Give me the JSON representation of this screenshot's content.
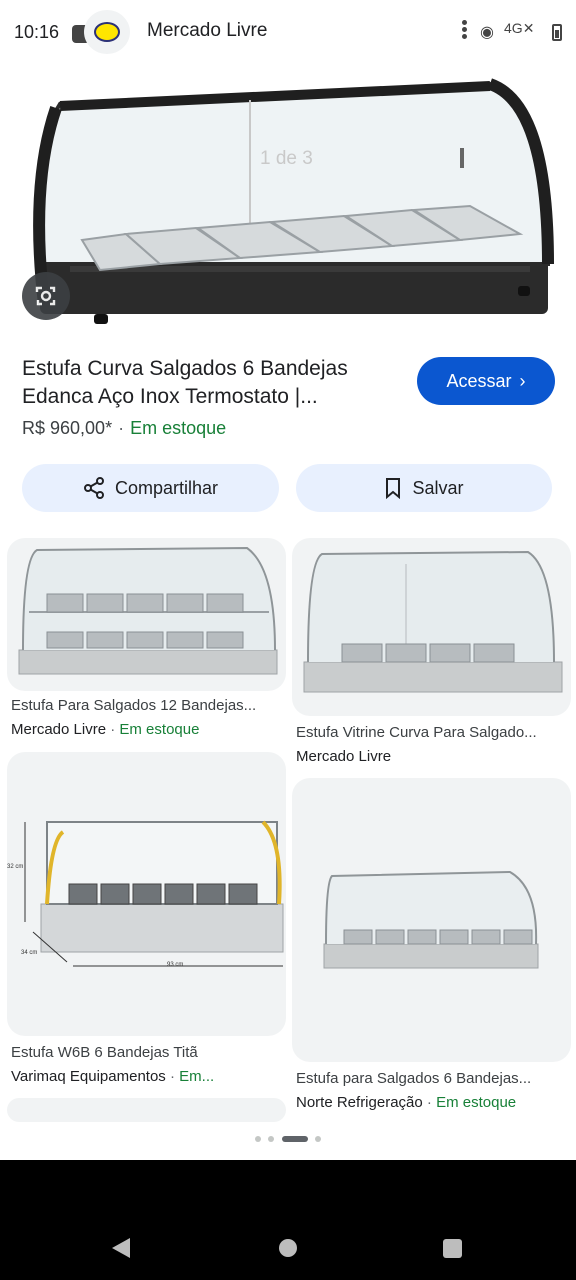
{
  "status_bar": {
    "time": "10:16",
    "network": "4G",
    "site_title": "Mercado Livre",
    "icons": [
      "logo-icon",
      "more-vert-icon",
      "wifi-icon",
      "signal-icon",
      "battery-icon"
    ]
  },
  "hero": {
    "page_indicator": "1 de 3",
    "lens_icon": "google-lens-icon"
  },
  "product": {
    "title_line1": "Estufa Curva Salgados 6 Bandejas",
    "title_line2": "Edanca Aço Inox Termostato |...",
    "price": "R$ 960,00*",
    "stock": "Em estoque",
    "separator": "·",
    "visit_label": "Acessar",
    "share_label": "Compartilhar",
    "save_label": "Salvar"
  },
  "results": [
    {
      "title": "Estufa Para Salgados 12 Bandejas...",
      "source": "Mercado Livre",
      "stock": "Em estoque"
    },
    {
      "title": "Estufa Vitrine Curva Para Salgado...",
      "source": "Mercado Livre",
      "stock": ""
    },
    {
      "title": "Estufa W6B 6 Bandejas Titã",
      "source": "Varimaq Equipamentos",
      "stock": "Em..."
    },
    {
      "title": "Estufa para Salgados 6 Bandejas...",
      "source": "Norte Refrigeração",
      "stock": "Em estoque"
    }
  ],
  "dimensions": {
    "height": "32 cm",
    "depth": "34 cm",
    "width": "93 cm"
  },
  "colors": {
    "accent": "#0b57d0",
    "tonal_button": "#e8f0fe",
    "stock_green": "#188038",
    "card_bg": "#f1f3f4"
  }
}
